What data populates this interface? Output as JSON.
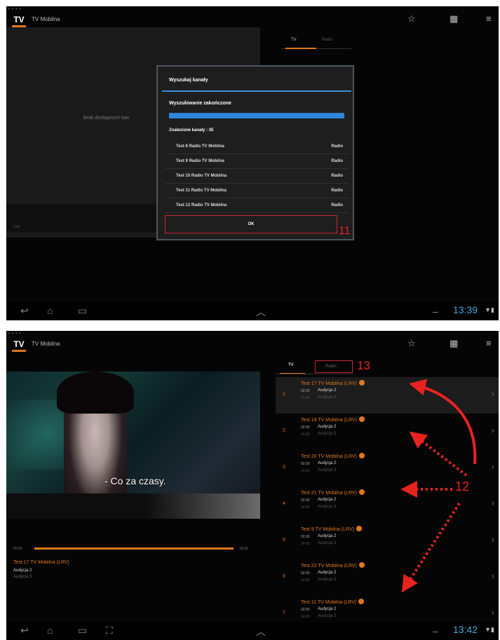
{
  "shot1": {
    "status_left": "▪ ▪ ▪ ▪",
    "logo": "TV",
    "app_title": "TV Mobilna",
    "empty_text": "Brak dostępnych kan",
    "prog_time": "0:00",
    "tabs": {
      "tv": "TV",
      "radio": "Radio"
    },
    "dialog": {
      "title": "Wyszukaj kanały",
      "status": "Wyszukiwanie zakończone",
      "progress": 1.0,
      "found": "Znalezione kanały : 35",
      "channels": [
        {
          "name": "Test 8 Radio TV Mobilna",
          "type": "Radio"
        },
        {
          "name": "Test 9 Radio TV Mobilna",
          "type": "Radio"
        },
        {
          "name": "Test 10 Radio TV Mobilna",
          "type": "Radio"
        },
        {
          "name": "Test 11 Radio TV Mobilna",
          "type": "Radio"
        },
        {
          "name": "Test 12 Radio TV Mobilna",
          "type": "Radio"
        }
      ],
      "ok": "OK"
    },
    "callout": "11",
    "clock": "13:39"
  },
  "shot2": {
    "status_left": "▪ ▪ ▪ ▪",
    "logo": "TV",
    "app_title": "TV Mobilna",
    "tabs": {
      "tv": "TV",
      "radio": "Radio"
    },
    "callout13": "13",
    "subtitle": "- Co za czasy.",
    "prog_start": "02:00",
    "prog_end": "14:00",
    "progress": 1.0,
    "now_channel": "Test 17 TV Mobilna (LRV)",
    "now_prog_a": "Audycja 2",
    "now_prog_b": "Audycja 3",
    "channels": [
      {
        "num": "1",
        "name": "Test 17 TV Mobilna (LRV)",
        "tA": "02:00",
        "pA": "Audycja 2",
        "tB": "14:00",
        "pB": "Audycja 3"
      },
      {
        "num": "2",
        "name": "Test 19 TV Mobilna (LRV)",
        "tA": "02:00",
        "pA": "Audycja 2",
        "tB": "14:00",
        "pB": "Audycja 3"
      },
      {
        "num": "3",
        "name": "Test 20 TV Mobilna (LRV)",
        "tA": "02:00",
        "pA": "Audycja 2",
        "tB": "14:00",
        "pB": "Audycja 3"
      },
      {
        "num": "4",
        "name": "Test 21 TV Mobilna (LRV)",
        "tA": "02:00",
        "pA": "Audycja 2",
        "tB": "14:00",
        "pB": "Audycja 3"
      },
      {
        "num": "5",
        "name": "Test 9 TV Mobilna (LRV)",
        "tA": "02:00",
        "pA": "Audycja 2",
        "tB": "14:00",
        "pB": "Audycja 3"
      },
      {
        "num": "6",
        "name": "Test 22 TV Mobilna (LRV)",
        "tA": "02:00",
        "pA": "Audycja 2",
        "tB": "14:00",
        "pB": "Audycja 3"
      },
      {
        "num": "7",
        "name": "Test 11 TV Mobilna (LRV)",
        "tA": "02:00",
        "pA": "Audycja 2",
        "tB": "14:00",
        "pB": "Audycja 3"
      }
    ],
    "callout12": "12",
    "clock": "13:42"
  },
  "icons": {
    "star": "☆",
    "calendar": "▦",
    "menu": "≡",
    "back": "↩",
    "home": "⌂",
    "recent": "▭",
    "screenshot": "⛶",
    "up": "︿",
    "chevron": "›",
    "sys": "▼▮",
    "dash": "–"
  },
  "colors": {
    "accent": "#e0761e",
    "highlight": "#2f86d8",
    "annotation": "#e8231f"
  }
}
